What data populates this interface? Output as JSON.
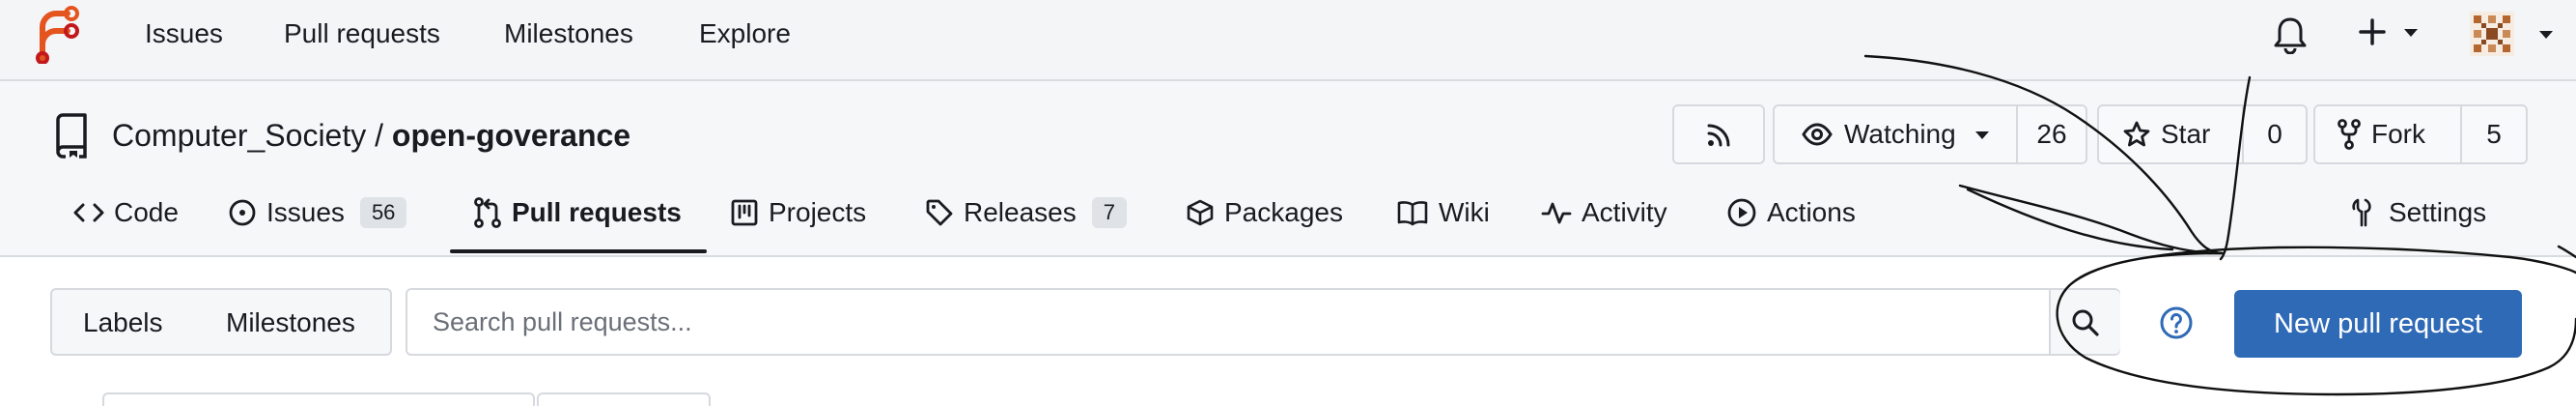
{
  "topnav": {
    "links": [
      "Issues",
      "Pull requests",
      "Milestones",
      "Explore"
    ],
    "icons": {
      "notifications": "bell-icon",
      "create": "plus-icon",
      "user": "avatar"
    }
  },
  "repo": {
    "owner": "Computer_Society",
    "separator": "/",
    "name": "open-goverance",
    "watch_label": "Watching",
    "watch_count": "26",
    "star_label": "Star",
    "star_count": "0",
    "fork_label": "Fork",
    "fork_count": "5"
  },
  "tabs": {
    "code": "Code",
    "issues": "Issues",
    "issues_count": "56",
    "pulls": "Pull requests",
    "projects": "Projects",
    "releases": "Releases",
    "releases_count": "7",
    "packages": "Packages",
    "wiki": "Wiki",
    "activity": "Activity",
    "actions": "Actions",
    "settings": "Settings"
  },
  "toolbar": {
    "labels": "Labels",
    "milestones": "Milestones",
    "search_placeholder": "Search pull requests...",
    "new_pr": "New pull request"
  },
  "colors": {
    "accent": "#2f6ab7",
    "logo": "#e4541f",
    "text": "#181c21",
    "border": "#d6d9de"
  }
}
